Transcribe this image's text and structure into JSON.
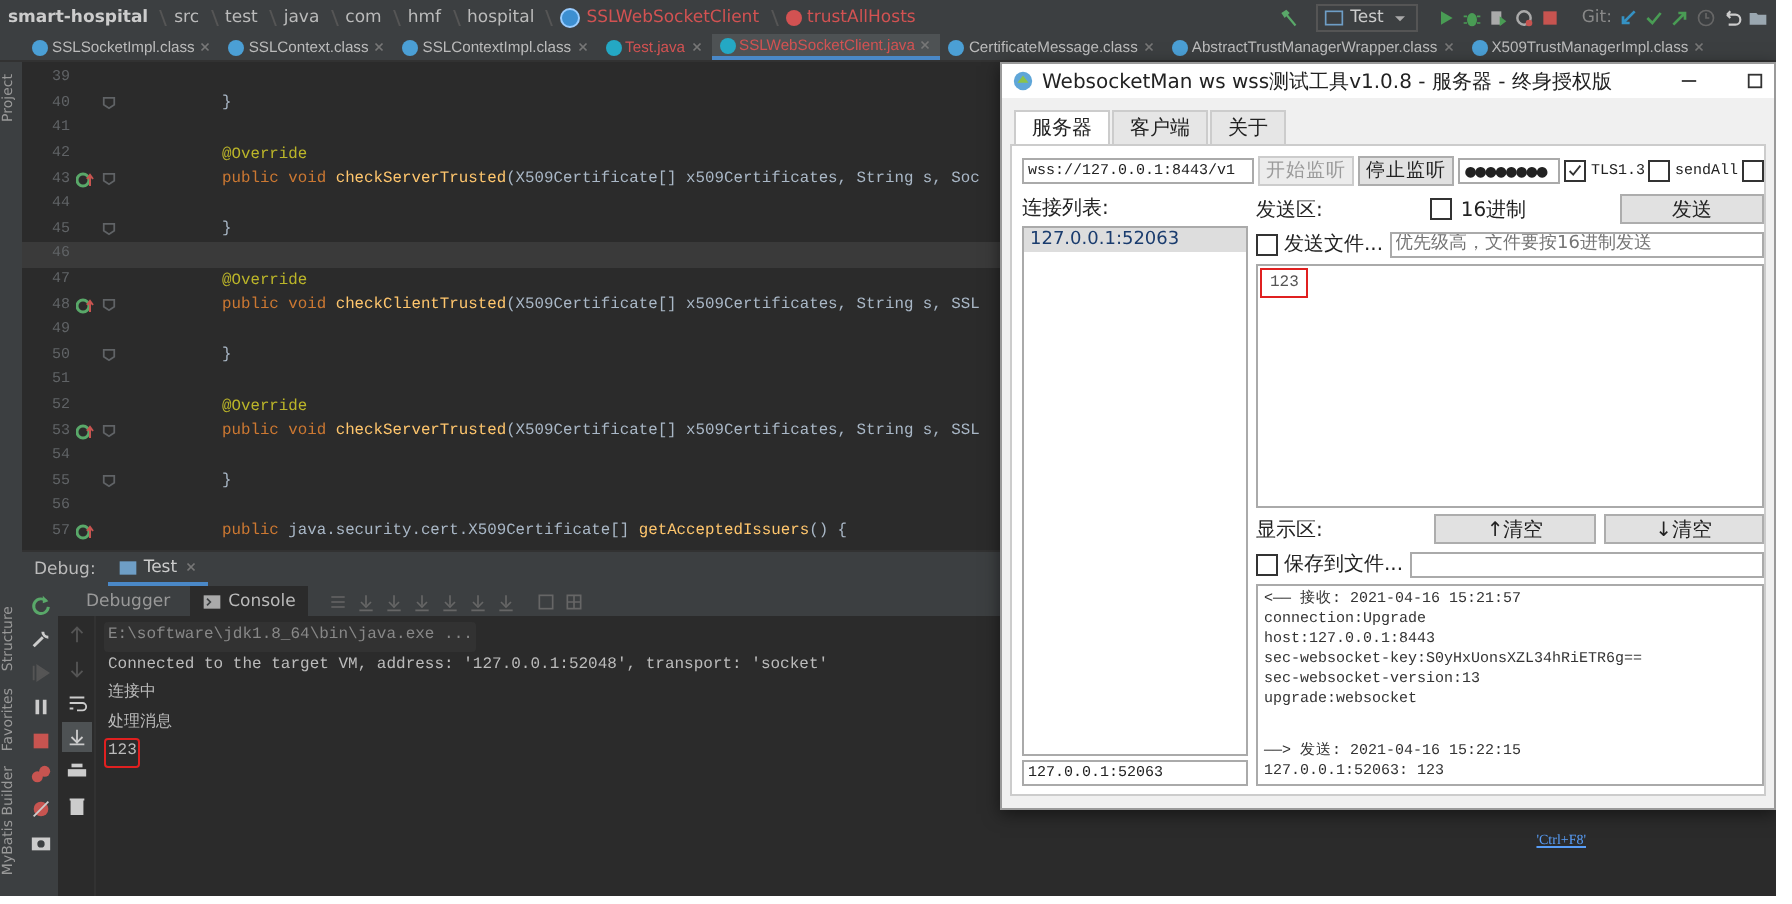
{
  "ide": {
    "breadcrumbs": [
      {
        "label": "smart-hospital",
        "kind": "project"
      },
      {
        "label": "src",
        "kind": "folder"
      },
      {
        "label": "test",
        "kind": "folder"
      },
      {
        "label": "java",
        "kind": "folder"
      },
      {
        "label": "com",
        "kind": "folder"
      },
      {
        "label": "hmf",
        "kind": "folder"
      },
      {
        "label": "hospital",
        "kind": "folder"
      },
      {
        "label": "SSLWebSocketClient",
        "kind": "class"
      },
      {
        "label": "trustAllHosts",
        "kind": "method"
      }
    ],
    "run_config": "Test",
    "git_label": "Git:",
    "tabs": [
      {
        "label": "SSLSocketImpl.class",
        "kind": "class",
        "error": false,
        "selected": false
      },
      {
        "label": "SSLContext.class",
        "kind": "class",
        "error": false,
        "selected": false
      },
      {
        "label": "SSLContextImpl.class",
        "kind": "class",
        "error": false,
        "selected": false
      },
      {
        "label": "Test.java",
        "kind": "java",
        "error": true,
        "selected": false
      },
      {
        "label": "SSLWebSocketClient.java",
        "kind": "java",
        "error": true,
        "selected": true
      },
      {
        "label": "CertificateMessage.class",
        "kind": "class",
        "error": false,
        "selected": false
      },
      {
        "label": "AbstractTrustManagerWrapper.class",
        "kind": "class",
        "error": false,
        "selected": false
      },
      {
        "label": "X509TrustManagerImpl.class",
        "kind": "class",
        "error": false,
        "selected": false
      }
    ],
    "top_tool": "Project",
    "bottom_tools": [
      "Structure",
      "Favorites",
      "MyBatis Builder"
    ],
    "lines": [
      {
        "number": "39"
      },
      {
        "number": "40",
        "fold": true,
        "segments": [
          {
            "text": "}",
            "kind": "plain"
          }
        ]
      },
      {
        "number": "41"
      },
      {
        "number": "42",
        "segments": [
          {
            "text": "@Override",
            "kind": "annotation"
          }
        ]
      },
      {
        "number": "43",
        "override": true,
        "fold": true,
        "segments": [
          {
            "text": "public void ",
            "kind": "keyword"
          },
          {
            "text": "checkServerTrusted",
            "kind": "method"
          },
          {
            "text": "(X509Certificate[] x509Certificates, String s, Soc",
            "kind": "plain"
          }
        ]
      },
      {
        "number": "44"
      },
      {
        "number": "45",
        "fold": true,
        "segments": [
          {
            "text": "}",
            "kind": "plain"
          }
        ]
      },
      {
        "number": "46",
        "current": true
      },
      {
        "number": "47",
        "segments": [
          {
            "text": "@Override",
            "kind": "annotation"
          }
        ]
      },
      {
        "number": "48",
        "override": true,
        "fold": true,
        "segments": [
          {
            "text": "public void ",
            "kind": "keyword"
          },
          {
            "text": "checkClientTrusted",
            "kind": "method"
          },
          {
            "text": "(X509Certificate[] x509Certificates, String s, SSL",
            "kind": "plain"
          }
        ]
      },
      {
        "number": "49"
      },
      {
        "number": "50",
        "fold": true,
        "segments": [
          {
            "text": "}",
            "kind": "plain"
          }
        ]
      },
      {
        "number": "51"
      },
      {
        "number": "52",
        "segments": [
          {
            "text": "@Override",
            "kind": "annotation"
          }
        ]
      },
      {
        "number": "53",
        "override": true,
        "fold": true,
        "segments": [
          {
            "text": "public void ",
            "kind": "keyword"
          },
          {
            "text": "checkServerTrusted",
            "kind": "method"
          },
          {
            "text": "(X509Certificate[] x509Certificates, String s, SSL",
            "kind": "plain"
          }
        ]
      },
      {
        "number": "54"
      },
      {
        "number": "55",
        "fold": true,
        "segments": [
          {
            "text": "}",
            "kind": "plain"
          }
        ]
      },
      {
        "number": "56"
      },
      {
        "number": "57",
        "override": true,
        "segments": [
          {
            "text": "public ",
            "kind": "keyword"
          },
          {
            "text": "java.security.cert.X509Certificate[] ",
            "kind": "plain"
          },
          {
            "text": "getAcceptedIssuers",
            "kind": "method"
          },
          {
            "text": "() {",
            "kind": "plain"
          }
        ]
      }
    ],
    "debug": {
      "label": "Debug:",
      "session_tab": "Test",
      "subtabs": [
        {
          "label": "Debugger",
          "selected": false
        },
        {
          "label": "Console",
          "selected": true
        }
      ],
      "console": [
        {
          "text": "E:\\software\\jdk1.8_64\\bin\\java.exe ...",
          "kind": "command",
          "highlighted": false
        },
        {
          "text": "Connected to the target VM, address: '127.0.0.1:52048', transport: 'socket'",
          "kind": "output",
          "highlighted": false
        },
        {
          "text": "连接中",
          "kind": "output",
          "highlighted": false
        },
        {
          "text": "处理消息",
          "kind": "output",
          "highlighted": false
        },
        {
          "text": "123",
          "kind": "output",
          "highlighted": true
        }
      ]
    },
    "hint": "'Ctrl+F8'"
  },
  "websocket_window": {
    "title": "WebsocketMan ws wss测试工具v1.0.8 - 服务器 - 终身授权版",
    "tabs": [
      {
        "label": "服务器",
        "selected": true
      },
      {
        "label": "客户端",
        "selected": false
      },
      {
        "label": "关于",
        "selected": false
      }
    ],
    "url": "wss://127.0.0.1:8443/v1",
    "start_button": {
      "label": "开始监听",
      "disabled": true
    },
    "stop_button": {
      "label": "停止监听",
      "disabled": false
    },
    "password": "●●●●●●●●",
    "options": [
      {
        "label": "TLS1.3",
        "checked": true
      },
      {
        "label": "sendAll",
        "checked": false
      },
      {
        "checked": false
      }
    ],
    "connections_label": "连接列表:",
    "connections": [
      {
        "label": "127.0.0.1:52063",
        "selected": true
      }
    ],
    "selected_connection": "127.0.0.1:52063",
    "send_label": "发送区:",
    "hex_option": {
      "label": "16进制",
      "checked": false
    },
    "send_button": "发送",
    "file_option": {
      "label": "发送文件...",
      "checked": false
    },
    "file_placeholder": "优先级高，文件要按16进制发送",
    "send_text": {
      "text": "123",
      "highlighted": true
    },
    "display_label": "显示区:",
    "clear_buttons": [
      "↑清空",
      "↓清空"
    ],
    "save_option": {
      "label": "保存到文件...",
      "checked": false
    },
    "display_blocks": [
      [
        "<—— 接收: 2021-04-16 15:21:57",
        "connection:Upgrade",
        "host:127.0.0.1:8443",
        "sec-websocket-key:S0yHxUonsXZL34hRiETR6g==",
        "sec-websocket-version:13",
        "upgrade:websocket"
      ],
      [
        "——> 发送: 2021-04-16 15:22:15",
        "127.0.0.1:52063: 123"
      ]
    ]
  }
}
